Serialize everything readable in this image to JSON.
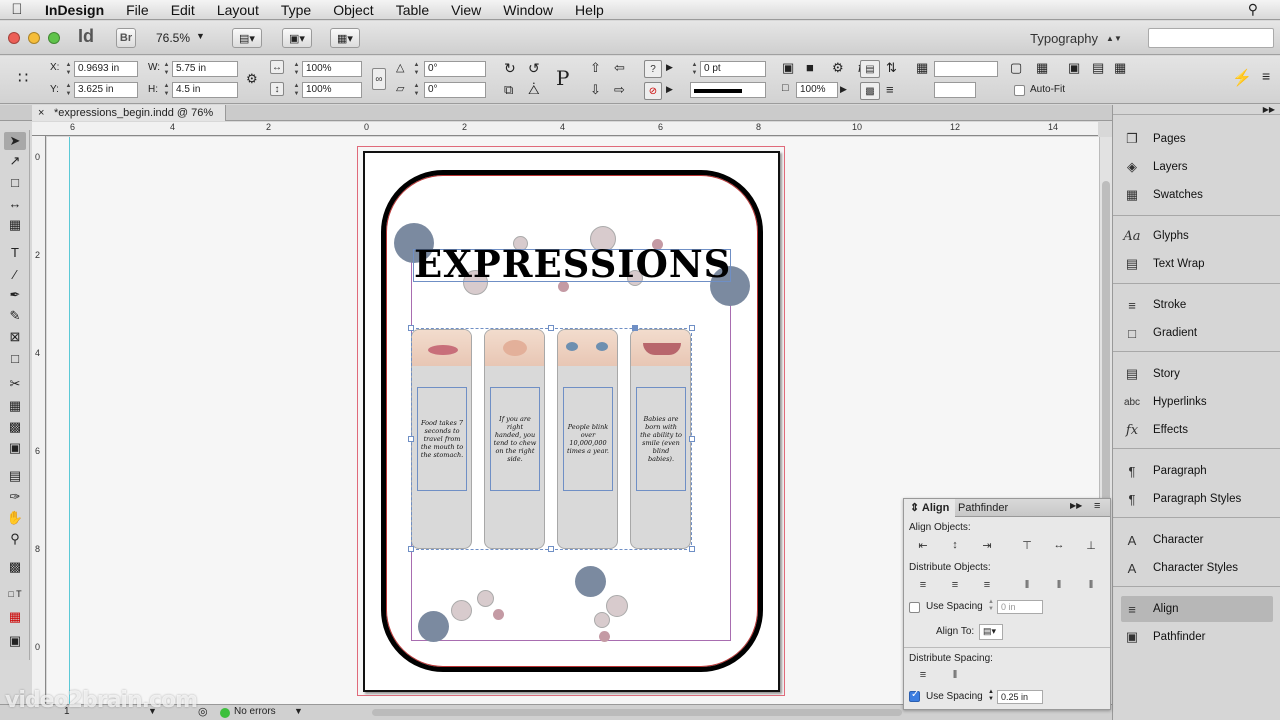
{
  "menubar": {
    "items": [
      "InDesign",
      "File",
      "Edit",
      "Layout",
      "Type",
      "Object",
      "Table",
      "View",
      "Window",
      "Help"
    ]
  },
  "appbar": {
    "logo": "Id",
    "bridge": "Br",
    "zoom": "76.5%",
    "workspace": "Typography"
  },
  "control": {
    "x_label": "X:",
    "x_value": "0.9693 in",
    "y_label": "Y:",
    "y_value": "3.625 in",
    "w_label": "W:",
    "w_value": "5.75 in",
    "h_label": "H:",
    "h_value": "4.5 in",
    "scale_x": "100%",
    "scale_y": "100%",
    "rotate": "0°",
    "shear": "0°",
    "stroke_weight": "0 pt",
    "opacity": "100%",
    "autofit": "Auto-Fit"
  },
  "document": {
    "tab_title": "*expressions_begin.indd @ 76%",
    "ruler_h": [
      "6",
      "4",
      "2",
      "0",
      "2",
      "4",
      "6",
      "8",
      "10",
      "12",
      "14"
    ],
    "ruler_v": [
      "0",
      "2",
      "4",
      "6",
      "8",
      "0"
    ]
  },
  "artwork": {
    "title": "EXPRESSIONS",
    "cards": [
      "Food takes 7 seconds to travel from the mouth to the stomach.",
      "If you are right handed, you tend to chew on the right side.",
      "People blink over 10,000,000 times a year.",
      "Babies are born with the ability to smile (even blind babies)."
    ]
  },
  "status": {
    "errors": "No errors",
    "page": "1"
  },
  "dock": {
    "items": [
      "Pages",
      "Layers",
      "Swatches",
      "Glyphs",
      "Text Wrap",
      "Stroke",
      "Gradient",
      "Story",
      "Hyperlinks",
      "Effects",
      "Paragraph",
      "Paragraph Styles",
      "Character",
      "Character Styles",
      "Align",
      "Pathfinder"
    ],
    "active": "Align"
  },
  "align_panel": {
    "tab_align": "Align",
    "tab_pathfinder": "Pathfinder",
    "align_objects": "Align Objects:",
    "distribute_objects": "Distribute Objects:",
    "use_spacing": "Use Spacing",
    "use_spacing_value": "0 in",
    "align_to": "Align To:",
    "distribute_spacing": "Distribute Spacing:",
    "use_spacing2": "Use Spacing",
    "use_spacing2_value": "0.25 in"
  },
  "watermark": "video2brain.com",
  "colors": {
    "dot_dark": "#7b8aa0",
    "dot_light": "#d8cbcd",
    "dot_pink": "#c49aa4",
    "select_blue": "#6f8fc5",
    "active_check": "#3b7de0"
  }
}
